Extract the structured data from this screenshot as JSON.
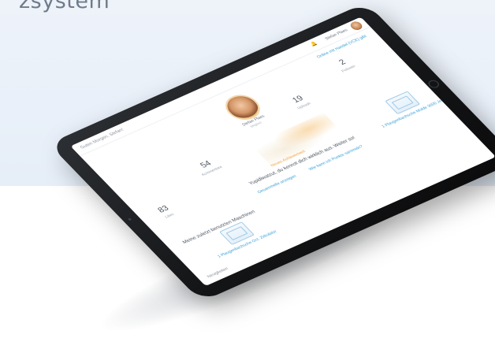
{
  "brand": {
    "text": "zsystem"
  },
  "topbar": {
    "welcome": "Guten Morgen, Stefan!",
    "username": "Stefan Plaes",
    "bell_icon": "bell-icon",
    "avatar_icon": "avatar-icon"
  },
  "profile": {
    "upgrade_link": "Online mit Handel (VCE) gibt",
    "name": "Stefan Plaes",
    "subtitle": "Mitglied"
  },
  "stats": [
    {
      "value": "83",
      "label": "Likes"
    },
    {
      "value": "54",
      "label": "Kommentare"
    },
    {
      "value": "19",
      "label": "Uploads"
    },
    {
      "value": "2",
      "label": "Follower"
    }
  ],
  "achievement": {
    "label": "Neues Achievement",
    "hint": "Yupidiwatzut, du kennst dich wirklich aus. Weiter so!",
    "link_primary": "Gesammelte anzeigen",
    "link_secondary": "Wie kann ich Punkte sammeln?"
  },
  "section": {
    "title": "Meine zuletzt benutzten Maschinen",
    "cards": [
      {
        "title": "1 Plaugenbachsche Oct. Zirkulator"
      },
      {
        "title": "1 Plaugenbachsche Mulde 3000 Jes"
      }
    ],
    "footer_label": "Neuigkeiten"
  },
  "colors": {
    "accent": "#3aa0d9",
    "highlight": "#f0a640",
    "device": "#141517"
  }
}
